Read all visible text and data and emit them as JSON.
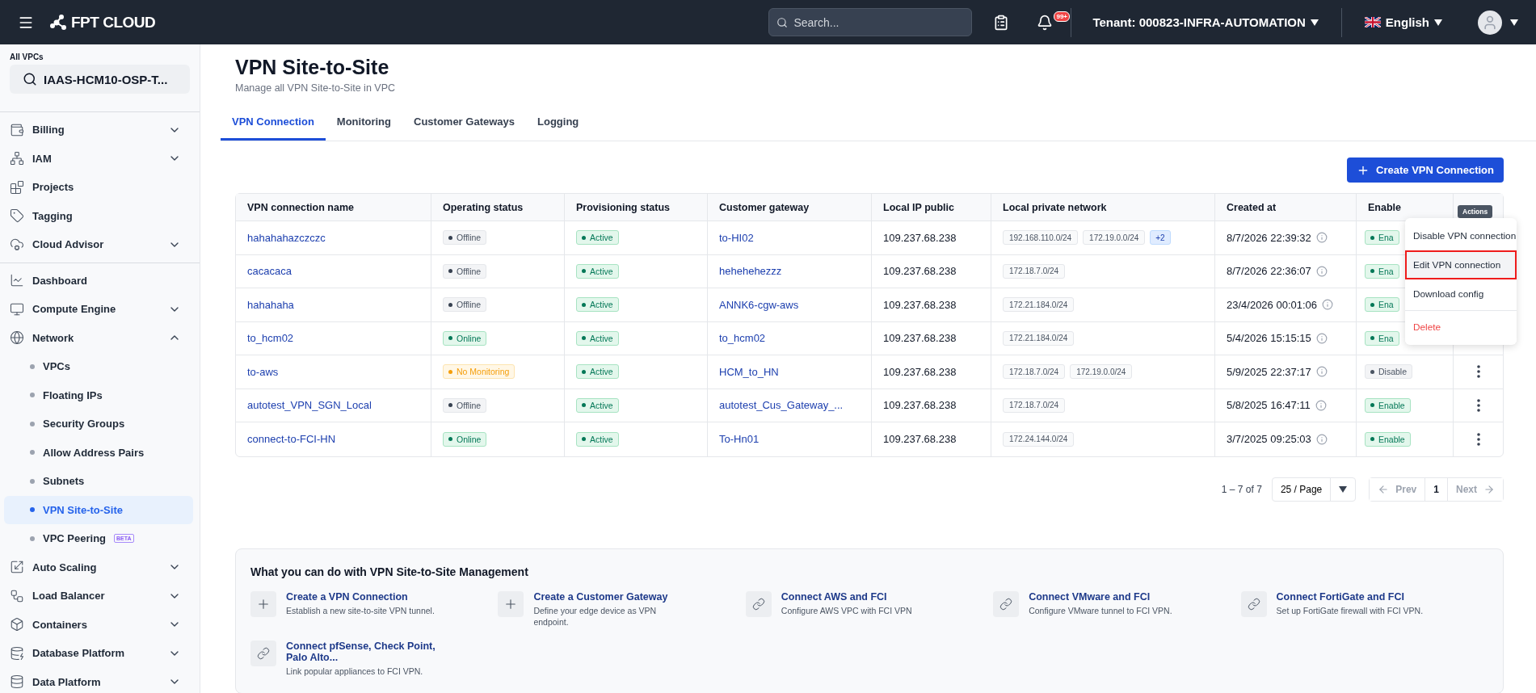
{
  "topbar": {
    "brand": "FPT CLOUD",
    "search_placeholder": "Search...",
    "notification_count": "99+",
    "tenant_label": "Tenant:",
    "tenant": "000823-INFRA-AUTOMATION",
    "language": "English"
  },
  "sidebar": {
    "vpc_label": "All VPCs",
    "vpc_value": "IAAS-HCM10-OSP-T...",
    "groups": [
      [
        {
          "label": "Billing",
          "expanded": false
        },
        {
          "label": "IAM",
          "expanded": false
        },
        {
          "label": "Projects"
        },
        {
          "label": "Tagging"
        },
        {
          "label": "Cloud Advisor",
          "expanded": false
        }
      ],
      [
        {
          "label": "Dashboard"
        },
        {
          "label": "Compute Engine",
          "expanded": false
        },
        {
          "label": "Network",
          "expanded": true,
          "children": [
            {
              "label": "VPCs",
              "selected": false
            },
            {
              "label": "Floating IPs",
              "selected": false
            },
            {
              "label": "Security Groups",
              "selected": false
            },
            {
              "label": "Allow Address Pairs",
              "selected": false
            },
            {
              "label": "Subnets",
              "selected": false
            },
            {
              "label": "VPN Site-to-Site",
              "selected": true
            },
            {
              "label": "VPC Peering",
              "selected": false,
              "badge": "BETA"
            }
          ]
        },
        {
          "label": "Auto Scaling",
          "expanded": false
        },
        {
          "label": "Load Balancer",
          "expanded": false
        },
        {
          "label": "Containers",
          "expanded": false
        },
        {
          "label": "Database Platform",
          "expanded": false
        },
        {
          "label": "Data Platform",
          "expanded": false
        }
      ]
    ]
  },
  "page": {
    "title": "VPN Site-to-Site",
    "subtitle": "Manage all VPN Site-to-Site in VPC",
    "tabs": [
      {
        "label": "VPN Connection",
        "selected": true
      },
      {
        "label": "Monitoring",
        "selected": false
      },
      {
        "label": "Customer Gateways",
        "selected": false
      },
      {
        "label": "Logging",
        "selected": false
      }
    ],
    "create_button": "Create VPN Connection",
    "table": {
      "columns": [
        "VPN connection name",
        "Operating status",
        "Provisioning status",
        "Customer gateway",
        "Local IP public",
        "Local private network",
        "Created at",
        "Enable"
      ],
      "rows": [
        {
          "name": "hahahahazczczc",
          "operating_status": {
            "label": "Offline",
            "kind": "offline"
          },
          "provisioning_status": {
            "label": "Active",
            "kind": "active"
          },
          "customer_gateway": "to-HI02",
          "local_ip": "109.237.68.238",
          "networks": [
            "192.168.110.0/24",
            "172.19.0.0/24"
          ],
          "more": "+2",
          "created_at": "8/7/2026 22:39:32",
          "enable": {
            "label": "Ena",
            "enabled": true
          },
          "actions_visible": false
        },
        {
          "name": "cacacaca",
          "operating_status": {
            "label": "Offline",
            "kind": "offline"
          },
          "provisioning_status": {
            "label": "Active",
            "kind": "active"
          },
          "customer_gateway": "hehehehezzz",
          "local_ip": "109.237.68.238",
          "networks": [
            "172.18.7.0/24"
          ],
          "created_at": "8/7/2026 22:36:07",
          "enable": {
            "label": "Ena",
            "enabled": true
          },
          "actions_visible": false
        },
        {
          "name": "hahahaha",
          "operating_status": {
            "label": "Offline",
            "kind": "offline"
          },
          "provisioning_status": {
            "label": "Active",
            "kind": "active"
          },
          "customer_gateway": "ANNK6-cgw-aws",
          "local_ip": "109.237.68.238",
          "networks": [
            "172.21.184.0/24"
          ],
          "created_at": "23/4/2026 00:01:06",
          "enable": {
            "label": "Ena",
            "enabled": true
          },
          "actions_visible": false
        },
        {
          "name": "to_hcm02",
          "operating_status": {
            "label": "Online",
            "kind": "online"
          },
          "provisioning_status": {
            "label": "Active",
            "kind": "active"
          },
          "customer_gateway": "to_hcm02",
          "local_ip": "109.237.68.238",
          "networks": [
            "172.21.184.0/24"
          ],
          "created_at": "5/4/2026 15:15:15",
          "enable": {
            "label": "Ena",
            "enabled": true
          },
          "actions_visible": false
        },
        {
          "name": "to-aws",
          "operating_status": {
            "label": "No Monitoring",
            "kind": "warning"
          },
          "provisioning_status": {
            "label": "Active",
            "kind": "active"
          },
          "customer_gateway": "HCM_to_HN",
          "local_ip": "109.237.68.238",
          "networks": [
            "172.18.7.0/24",
            "172.19.0.0/24"
          ],
          "created_at": "5/9/2025 22:37:17",
          "enable": {
            "label": "Disable",
            "enabled": false
          },
          "actions_visible": true
        },
        {
          "name": "autotest_VPN_SGN_Local",
          "operating_status": {
            "label": "Offline",
            "kind": "offline"
          },
          "provisioning_status": {
            "label": "Active",
            "kind": "active"
          },
          "customer_gateway": "autotest_Cus_Gateway_...",
          "local_ip": "109.237.68.238",
          "networks": [
            "172.18.7.0/24"
          ],
          "created_at": "5/8/2025 16:47:11",
          "enable": {
            "label": "Enable",
            "enabled": true
          },
          "actions_visible": true
        },
        {
          "name": "connect-to-FCI-HN",
          "operating_status": {
            "label": "Online",
            "kind": "online"
          },
          "provisioning_status": {
            "label": "Active",
            "kind": "active"
          },
          "customer_gateway": "To-Hn01",
          "local_ip": "109.237.68.238",
          "networks": [
            "172.24.144.0/24"
          ],
          "created_at": "3/7/2025 09:25:03",
          "enable": {
            "label": "Enable",
            "enabled": true
          },
          "actions_visible": true
        }
      ]
    },
    "actions_tooltip": "Actions",
    "menu": [
      {
        "label": "Disable VPN connection",
        "kind": "normal",
        "highlighted": false
      },
      {
        "label": "Edit VPN connection",
        "kind": "normal",
        "highlighted": true
      },
      {
        "label": "Download config",
        "kind": "normal",
        "highlighted": false
      },
      {
        "label": "Delete",
        "kind": "danger",
        "highlighted": false
      }
    ],
    "pagination": {
      "range": "1 – 7 of 7",
      "page_size": "25 / Page",
      "prev": "Prev",
      "pages": [
        {
          "label": "1",
          "selected": true
        }
      ],
      "next": "Next"
    },
    "help": {
      "title": "What you can do with VPN Site-to-Site Management",
      "items": [
        {
          "title": "Create a VPN Connection",
          "description": "Establish a new site-to-site VPN tunnel.",
          "kind": "plus"
        },
        {
          "title": "Create a Customer Gateway",
          "description": "Define your edge device as VPN endpoint.",
          "kind": "plus"
        },
        {
          "title": "Connect AWS and FCI",
          "description": "Configure AWS VPC with FCI VPN",
          "kind": "link"
        },
        {
          "title": "Connect VMware and FCI",
          "description": "Configure VMware tunnel to FCI VPN.",
          "kind": "link"
        },
        {
          "title": "Connect FortiGate and FCI",
          "description": "Set up FortiGate firewall with FCI VPN.",
          "kind": "link"
        },
        {
          "title": "Connect pfSense, Check Point, Palo Alto...",
          "description": "Link popular appliances to FCI VPN.",
          "kind": "link"
        }
      ]
    }
  }
}
